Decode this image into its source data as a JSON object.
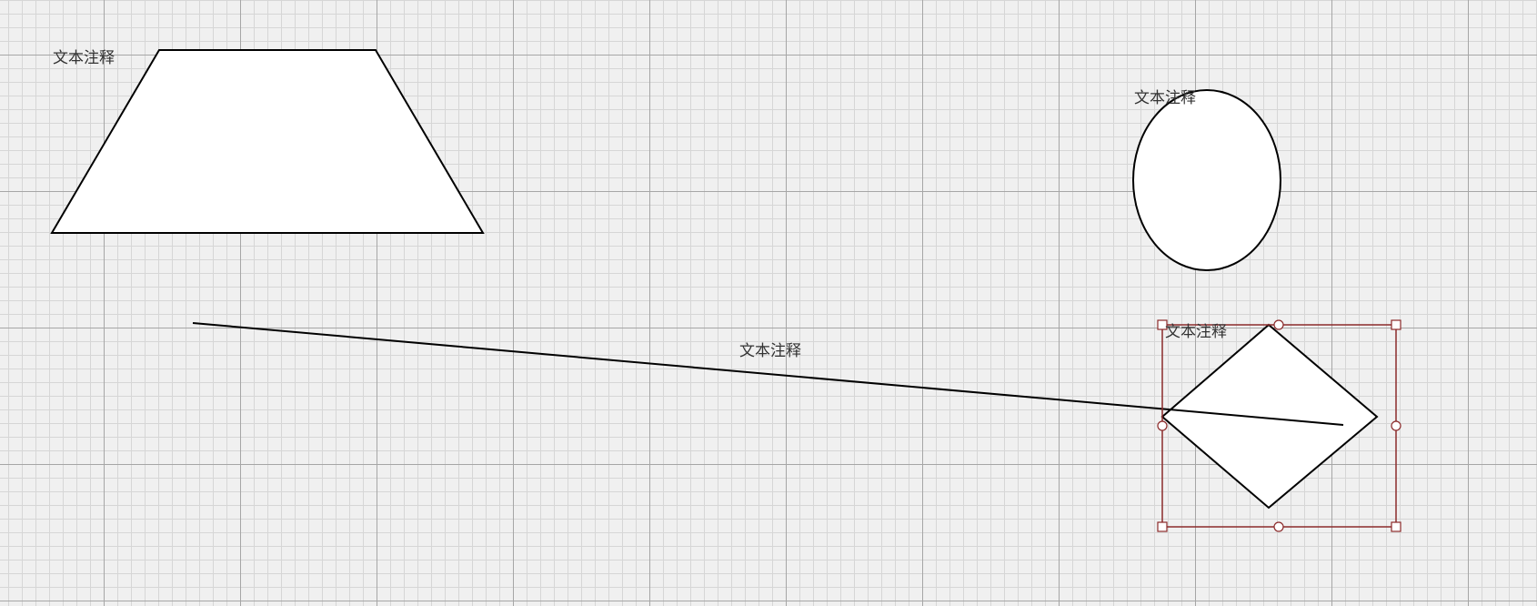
{
  "canvas": {
    "background_color": "#f0f0f0",
    "grid_major_color": "#a6a6a6",
    "grid_minor_color": "#d6d6d6",
    "shape_fill": "#ffffff",
    "shape_stroke": "#000000",
    "selection_color": "#8b2a2a"
  },
  "shapes": {
    "trapezoid": {
      "label": "文本注释"
    },
    "ellipse": {
      "label": "文本注释"
    },
    "line": {
      "label": "文本注释"
    },
    "diamond": {
      "label": "文本注释",
      "selected": true
    }
  }
}
